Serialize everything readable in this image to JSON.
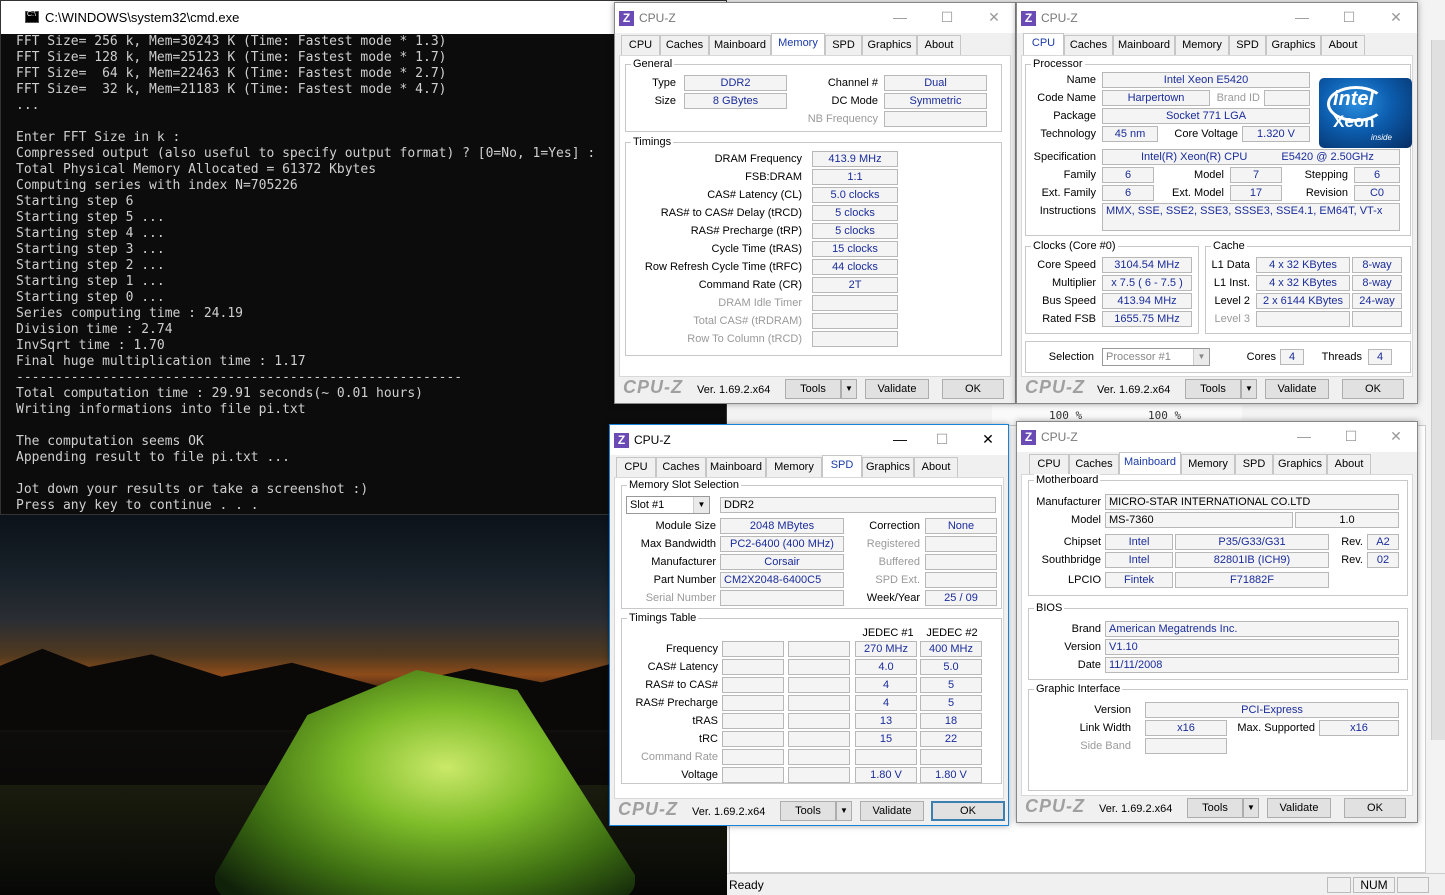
{
  "cmd": {
    "title": "C:\\WINDOWS\\system32\\cmd.exe",
    "lines": [
      "FFT Size= 256 k, Mem=30243 K (Time: Fastest mode * 1.3)",
      "FFT Size= 128 k, Mem=25123 K (Time: Fastest mode * 1.7)",
      "FFT Size=  64 k, Mem=22463 K (Time: Fastest mode * 2.7)",
      "FFT Size=  32 k, Mem=21183 K (Time: Fastest mode * 4.7)",
      "...",
      "",
      "Enter FFT Size in k :",
      "Compressed output (also useful to specify output format) ? [0=No, 1=Yes] :",
      "Total Physical Memory Allocated = 61372 Kbytes",
      "Computing series with index N=705226",
      "Starting step 6",
      "Starting step 5 ...",
      "Starting step 4 ...",
      "Starting step 3 ...",
      "Starting step 2 ...",
      "Starting step 1 ...",
      "Starting step 0 ...",
      "Series computing time : 24.19",
      "Division time : 2.74",
      "InvSqrt time : 1.70",
      "Final huge multiplication time : 1.17",
      "---------------------------------------------------------",
      "Total computation time : 29.91 seconds(~ 0.01 hours)",
      "Writing informations into file pi.txt",
      "",
      "The computation seems OK",
      "Appending result to file pi.txt ...",
      "",
      "Jot down your results or take a screenshot :)",
      "Press any key to continue . . ."
    ]
  },
  "background_app": {
    "pane_left": "100 %",
    "pane_right": "100 %",
    "status_ready": "Ready",
    "status_num": "NUM"
  },
  "common": {
    "app_name": "CPU-Z",
    "brand": "CPU-Z",
    "version": "Ver. 1.69.2.x64",
    "tools": "Tools",
    "validate": "Validate",
    "ok": "OK",
    "minimize": "—",
    "maximize": "☐",
    "close": "✕",
    "tabs": [
      "CPU",
      "Caches",
      "Mainboard",
      "Memory",
      "SPD",
      "Graphics",
      "About"
    ]
  },
  "memory": {
    "general_title": "General",
    "type_label": "Type",
    "type": "DDR2",
    "size_label": "Size",
    "size": "8 GBytes",
    "channel_label": "Channel #",
    "channel": "Dual",
    "dcmode_label": "DC Mode",
    "dcmode": "Symmetric",
    "nbfreq_label": "NB Frequency",
    "nbfreq": "",
    "timings_title": "Timings",
    "rows": [
      {
        "label": "DRAM Frequency",
        "value": "413.9 MHz",
        "disabled": false
      },
      {
        "label": "FSB:DRAM",
        "value": "1:1",
        "disabled": false
      },
      {
        "label": "CAS# Latency (CL)",
        "value": "5.0 clocks",
        "disabled": false
      },
      {
        "label": "RAS# to CAS# Delay (tRCD)",
        "value": "5 clocks",
        "disabled": false
      },
      {
        "label": "RAS# Precharge (tRP)",
        "value": "5 clocks",
        "disabled": false
      },
      {
        "label": "Cycle Time (tRAS)",
        "value": "15 clocks",
        "disabled": false
      },
      {
        "label": "Row Refresh Cycle Time (tRFC)",
        "value": "44 clocks",
        "disabled": false
      },
      {
        "label": "Command Rate (CR)",
        "value": "2T",
        "disabled": false
      },
      {
        "label": "DRAM Idle Timer",
        "value": "",
        "disabled": true
      },
      {
        "label": "Total CAS# (tRDRAM)",
        "value": "",
        "disabled": true
      },
      {
        "label": "Row To Column (tRCD)",
        "value": "",
        "disabled": true
      }
    ]
  },
  "cpu": {
    "processor_title": "Processor",
    "name_label": "Name",
    "name": "Intel Xeon E5420",
    "codename_label": "Code Name",
    "codename": "Harpertown",
    "brandid_label": "Brand ID",
    "brandid": "",
    "package_label": "Package",
    "package": "Socket 771 LGA",
    "technology_label": "Technology",
    "technology": "45 nm",
    "corevoltage_label": "Core Voltage",
    "corevoltage": "1.320 V",
    "spec_label": "Specification",
    "spec_a": "Intel(R) Xeon(R) CPU",
    "spec_b": "E5420  @ 2.50GHz",
    "family_label": "Family",
    "family": "6",
    "model_label": "Model",
    "model": "7",
    "stepping_label": "Stepping",
    "stepping": "6",
    "extfamily_label": "Ext. Family",
    "extfamily": "6",
    "extmodel_label": "Ext. Model",
    "extmodel": "17",
    "revision_label": "Revision",
    "revision": "C0",
    "instructions_label": "Instructions",
    "instructions": "MMX, SSE, SSE2, SSE3, SSSE3, SSE4.1, EM64T, VT-x",
    "logo_word": "intel",
    "logo_product": "Xeon",
    "logo_inside": "inside",
    "clocks_title": "Clocks (Core #0)",
    "corespeed_label": "Core Speed",
    "corespeed": "3104.54 MHz",
    "multiplier_label": "Multiplier",
    "multiplier": "x 7.5 ( 6 - 7.5 )",
    "busspeed_label": "Bus Speed",
    "busspeed": "413.94 MHz",
    "ratedfsb_label": "Rated FSB",
    "ratedfsb": "1655.75 MHz",
    "cache_title": "Cache",
    "l1d_label": "L1 Data",
    "l1d": "4 x 32 KBytes",
    "l1d_way": "8-way",
    "l1i_label": "L1 Inst.",
    "l1i": "4 x 32 KBytes",
    "l1i_way": "8-way",
    "l2_label": "Level 2",
    "l2": "2 x 6144 KBytes",
    "l2_way": "24-way",
    "l3_label": "Level 3",
    "l3": "",
    "l3_way": "",
    "selection_label": "Selection",
    "selection": "Processor #1",
    "cores_label": "Cores",
    "cores": "4",
    "threads_label": "Threads",
    "threads": "4"
  },
  "spd": {
    "slot_title": "Memory Slot Selection",
    "slot": "Slot #1",
    "slot_type": "DDR2",
    "modulesize_label": "Module Size",
    "modulesize": "2048 MBytes",
    "maxbw_label": "Max Bandwidth",
    "maxbw": "PC2-6400 (400 MHz)",
    "manufacturer_label": "Manufacturer",
    "manufacturer": "Corsair",
    "partnumber_label": "Part Number",
    "partnumber": "CM2X2048-6400C5",
    "serial_label": "Serial Number",
    "serial": "",
    "correction_label": "Correction",
    "correction": "None",
    "registered_label": "Registered",
    "registered": "",
    "buffered_label": "Buffered",
    "buffered": "",
    "spdext_label": "SPD Ext.",
    "spdext": "",
    "weekyear_label": "Week/Year",
    "weekyear": "25 / 09",
    "timings_title": "Timings Table",
    "col_headers": [
      "JEDEC #1",
      "JEDEC #2"
    ],
    "rows": [
      {
        "label": "Frequency",
        "j1": "270 MHz",
        "j2": "400 MHz",
        "disabled": false
      },
      {
        "label": "CAS# Latency",
        "j1": "4.0",
        "j2": "5.0",
        "disabled": false
      },
      {
        "label": "RAS# to CAS#",
        "j1": "4",
        "j2": "5",
        "disabled": false
      },
      {
        "label": "RAS# Precharge",
        "j1": "4",
        "j2": "5",
        "disabled": false
      },
      {
        "label": "tRAS",
        "j1": "13",
        "j2": "18",
        "disabled": false
      },
      {
        "label": "tRC",
        "j1": "15",
        "j2": "22",
        "disabled": false
      },
      {
        "label": "Command Rate",
        "j1": "",
        "j2": "",
        "disabled": true
      },
      {
        "label": "Voltage",
        "j1": "1.80 V",
        "j2": "1.80 V",
        "disabled": false
      }
    ]
  },
  "mainboard": {
    "mb_title": "Motherboard",
    "manufacturer_label": "Manufacturer",
    "manufacturer": "MICRO-STAR INTERNATIONAL CO.LTD",
    "model_label": "Model",
    "model": "MS-7360",
    "model_rev": "1.0",
    "chipset_label": "Chipset",
    "chipset_vendor": "Intel",
    "chipset": "P35/G33/G31",
    "chipset_rev_label": "Rev.",
    "chipset_rev": "A2",
    "south_label": "Southbridge",
    "south_vendor": "Intel",
    "south": "82801IB (ICH9)",
    "south_rev_label": "Rev.",
    "south_rev": "02",
    "lpcio_label": "LPCIO",
    "lpcio_vendor": "Fintek",
    "lpcio": "F71882F",
    "bios_title": "BIOS",
    "brand_label": "Brand",
    "brand": "American Megatrends Inc.",
    "version_label": "Version",
    "version": "V1.10",
    "date_label": "Date",
    "date": "11/11/2008",
    "gi_title": "Graphic Interface",
    "gi_version_label": "Version",
    "gi_version": "PCI-Express",
    "linkwidth_label": "Link Width",
    "linkwidth": "x16",
    "maxsup_label": "Max. Supported",
    "maxsup": "x16",
    "sideband_label": "Side Band",
    "sideband": ""
  }
}
